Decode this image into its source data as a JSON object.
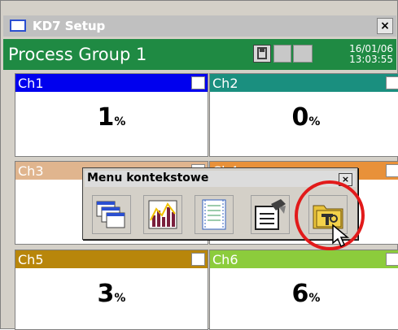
{
  "window": {
    "title": "KD7 Setup",
    "close_label": "×"
  },
  "header": {
    "group_name": "Process Group 1",
    "date": "16/01/06",
    "time": "13:03:55",
    "bg_color": "#1f8a43"
  },
  "channels": [
    {
      "name": "Ch1",
      "value": "1",
      "unit": "%",
      "color": "#0000ee"
    },
    {
      "name": "Ch2",
      "value": "0",
      "unit": "%",
      "color": "#1a8f7f"
    },
    {
      "name": "Ch3",
      "color": "#e0b58e"
    },
    {
      "name": "Ch4",
      "color": "#e8913a"
    },
    {
      "name": "Ch5",
      "value": "3",
      "unit": "%",
      "color": "#b8860b"
    },
    {
      "name": "Ch6",
      "value": "6",
      "unit": "%",
      "color": "#8ccc3c"
    }
  ],
  "context_menu": {
    "title": "Menu kontekstowe",
    "close_label": "×",
    "items": [
      {
        "icon": "windows-icon"
      },
      {
        "icon": "trend-chart-icon"
      },
      {
        "icon": "log-page-icon"
      },
      {
        "icon": "edit-document-icon"
      },
      {
        "icon": "setup-folder-icon"
      }
    ]
  },
  "annotation_color": "#e21a1a"
}
